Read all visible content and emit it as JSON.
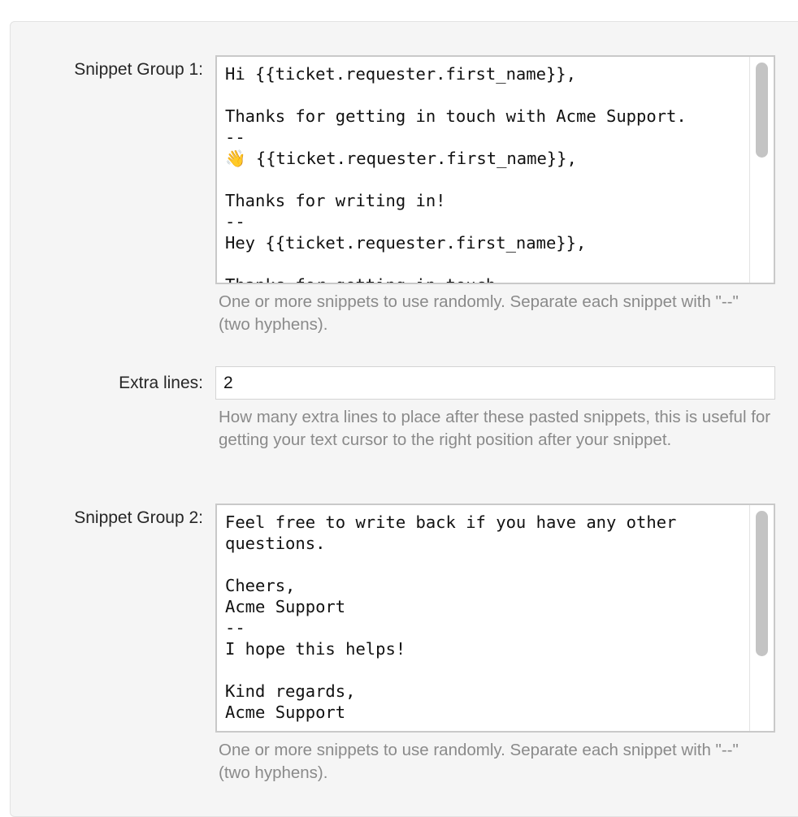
{
  "group1": {
    "label": "Snippet Group 1:",
    "lines": [
      "Hi {{ticket.requester.first_name}},",
      "",
      "Thanks for getting in touch with Acme Support.",
      "--",
      " {{ticket.requester.first_name}},",
      "",
      "Thanks for writing in!",
      "--",
      "Hey {{ticket.requester.first_name}},",
      "",
      "Thanks for getting in touch."
    ],
    "emoji": "👋",
    "help": "One or more snippets to use randomly. Separate each snippet with \"--\" (two hyphens)."
  },
  "extra_lines": {
    "label": "Extra lines:",
    "value": "2",
    "help": "How many extra lines to place after these pasted snippets, this is useful for getting your text cursor to the right position after your snippet."
  },
  "group2": {
    "label": "Snippet Group 2:",
    "lines": [
      "Feel free to write back if you have any other",
      "questions.",
      "",
      "Cheers,",
      "Acme Support",
      "--",
      "I hope this helps!",
      "",
      "Kind regards,",
      "Acme Support"
    ],
    "help": "One or more snippets to use randomly. Separate each snippet with \"--\" (two hyphens)."
  }
}
